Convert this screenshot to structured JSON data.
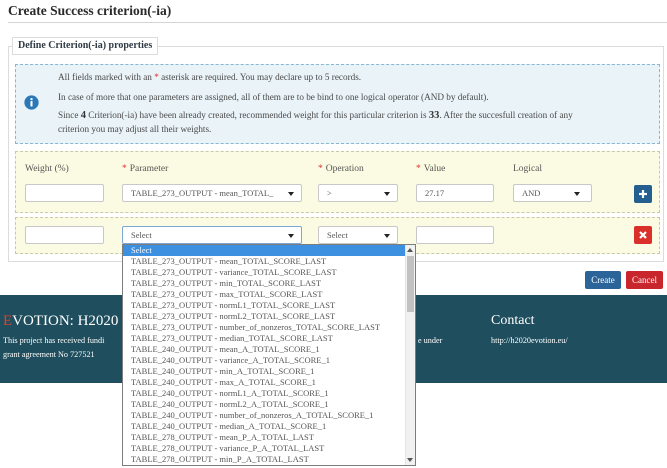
{
  "page": {
    "title": "Create Success criterion(-ia)"
  },
  "properties": {
    "legend": "Define Criterion(-ia) properties"
  },
  "notice": {
    "icon": "info-icon",
    "line1": {
      "before": "All fields marked with an ",
      "asterisk": "*",
      "after": " asterisk are required. You may declare up to 5 records."
    },
    "line2": "In case of more that one parameters are assigned, all of them are to be bind to one logical operator (AND by default).",
    "line3": {
      "before": "Since ",
      "created_count": "4",
      "middle": " Criterion(-ia) have been already created, recommended weight for this particular criterion is ",
      "recommended_weight": "33",
      "after": ". After the succesfull creation of any"
    },
    "line4": "criterion you may adjust all their weights."
  },
  "columns": {
    "required_mark": "*",
    "weight": "Weight (%)",
    "parameter": "Parameter",
    "operation": "Operation",
    "value": "Value",
    "logical": "Logical"
  },
  "rows": [
    {
      "weight": "",
      "parameter": "TABLE_273_OUTPUT - mean_TOTAL_",
      "operation": ">",
      "value": "27.17",
      "logical": "AND",
      "action_icon": "plus-icon"
    },
    {
      "weight": "",
      "parameter": "Select",
      "operation": "Select",
      "value": "",
      "action_icon": "close-icon"
    }
  ],
  "parameter_dropdown": {
    "highlighted_index": 0,
    "options": [
      "Select",
      "TABLE_273_OUTPUT - mean_TOTAL_SCORE_LAST",
      "TABLE_273_OUTPUT - variance_TOTAL_SCORE_LAST",
      "TABLE_273_OUTPUT - min_TOTAL_SCORE_LAST",
      "TABLE_273_OUTPUT - max_TOTAL_SCORE_LAST",
      "TABLE_273_OUTPUT - normL1_TOTAL_SCORE_LAST",
      "TABLE_273_OUTPUT - normL2_TOTAL_SCORE_LAST",
      "TABLE_273_OUTPUT - number_of_nonzeros_TOTAL_SCORE_LAST",
      "TABLE_273_OUTPUT - median_TOTAL_SCORE_LAST",
      "TABLE_240_OUTPUT - mean_A_TOTAL_SCORE_1",
      "TABLE_240_OUTPUT - variance_A_TOTAL_SCORE_1",
      "TABLE_240_OUTPUT - min_A_TOTAL_SCORE_1",
      "TABLE_240_OUTPUT - max_A_TOTAL_SCORE_1",
      "TABLE_240_OUTPUT - normL1_A_TOTAL_SCORE_1",
      "TABLE_240_OUTPUT - normL2_A_TOTAL_SCORE_1",
      "TABLE_240_OUTPUT - number_of_nonzeros_A_TOTAL_SCORE_1",
      "TABLE_240_OUTPUT - median_A_TOTAL_SCORE_1",
      "TABLE_278_OUTPUT - mean_P_A_TOTAL_LAST",
      "TABLE_278_OUTPUT - variance_P_A_TOTAL_LAST",
      "TABLE_278_OUTPUT - min_P_A_TOTAL_LAST"
    ]
  },
  "actions": {
    "create": "Create",
    "cancel": "Cancel"
  },
  "footer": {
    "brand_initial": "E",
    "brand_rest": "VOTION: H2020",
    "funding_line1_start": "This project has received fundi",
    "funding_line1_end": "e under",
    "funding_line2": "grant agreement No 727521",
    "contact_heading": "Contact",
    "contact_url": "http://h2020evotion.eu/"
  },
  "colors": {
    "notice_bg": "#e9f3f8",
    "info_icon": "#2a78b8",
    "required": "#e0302a",
    "row_bg": "#fbfbe3",
    "add_button": "#245f8f",
    "remove_button": "#d9302c",
    "highlight": "#3d8fe0",
    "create_button": "#2a6499",
    "cancel_button": "#c9252c",
    "footer_bg": "#1f4e5e",
    "brand_initial": "#e2402d"
  }
}
